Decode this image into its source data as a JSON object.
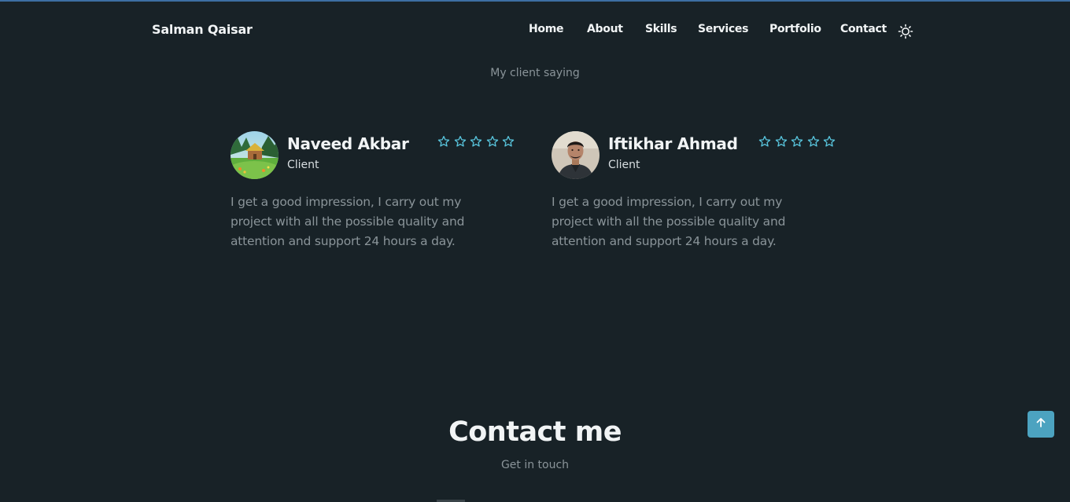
{
  "header": {
    "logo": "Salman Qaisar",
    "nav": [
      "Home",
      "About",
      "Skills",
      "Services",
      "Portfolio",
      "Contact"
    ],
    "theme_icon": "sun-icon"
  },
  "testimonials": {
    "subtitle": "My client saying",
    "items": [
      {
        "name": "Naveed Akbar",
        "role": "Client",
        "rating": 5,
        "quote": "I get a good impression, I carry out my project with all the possible quality and attention and support 24 hours a day."
      },
      {
        "name": "Iftikhar Ahmad",
        "role": "Client",
        "rating": 5,
        "quote": "I get a good impression, I carry out my project with all the possible quality and attention and support 24 hours a day."
      }
    ]
  },
  "contact": {
    "title": "Contact me",
    "subtitle": "Get in touch"
  },
  "colors": {
    "background": "#182227",
    "accent": "#4ca3c0",
    "star": "#58c4dc"
  },
  "scroll_icon": "arrow-up-icon"
}
